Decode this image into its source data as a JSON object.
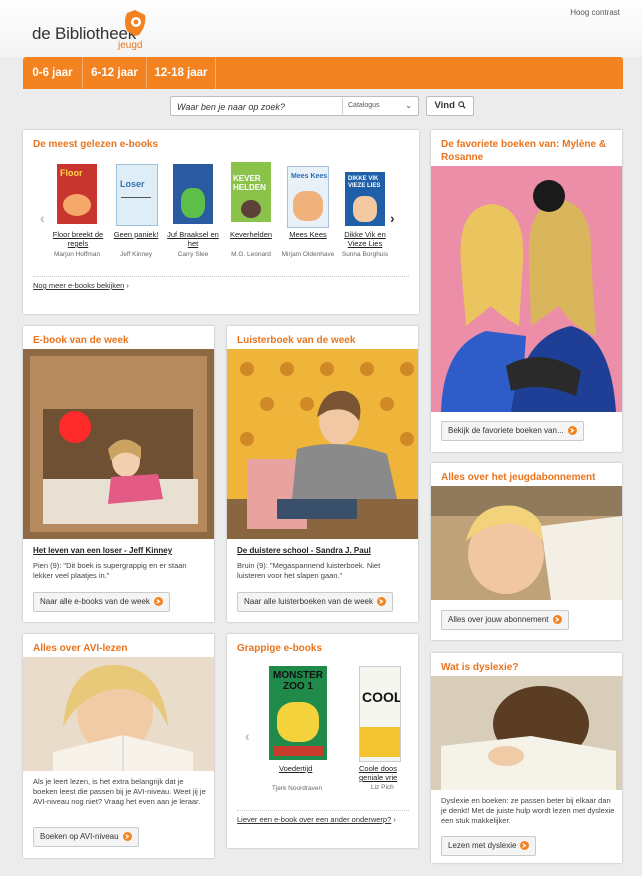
{
  "header": {
    "logo_text": "de Bibliotheek",
    "logo_sub": "jeugd",
    "contrast_link": "Hoog contrast"
  },
  "nav": {
    "tabs": [
      "0-6 jaar",
      "6-12 jaar",
      "12-18 jaar"
    ]
  },
  "search": {
    "placeholder": "Waar ben je naar op zoek?",
    "select_value": "Catalogus",
    "button": "Vind"
  },
  "colors": {
    "accent": "#f38220",
    "title": "#e8741e"
  },
  "most_read": {
    "title": "De meest gelezen e-books",
    "books": [
      {
        "title": "Floor breekt de regels",
        "author": "Marjon Hoffman",
        "color": "#c8352e"
      },
      {
        "title": "Geen paniek!",
        "author": "Jeff Kinney",
        "color": "#8fbcd8"
      },
      {
        "title": "Juf Braaksel en het",
        "author": "Carry Slee",
        "color": "#2a5aa0"
      },
      {
        "title": "Keverhelden",
        "author": "M.G. Leonard",
        "color": "#7cb342"
      },
      {
        "title": "Mees Kees",
        "author": "Mirjam Oldenhave",
        "color": "#3a78c2"
      },
      {
        "title": "Dikke Vik en Vieze Lies",
        "author": "Sunna Borghuis",
        "color": "#1e5fa8"
      }
    ],
    "more_link": "Nog meer e-books bekijken"
  },
  "favorites": {
    "title": "De favoriete boeken van: Mylène & Rosanne",
    "button": "Bekijk de favoriete boeken van..."
  },
  "ebook_week": {
    "title": "E-book van de week",
    "book": "Het leven van een loser - Jeff Kinney",
    "text": "Pien (9): \"Dit boek is supergrappig en er staan lekker veel plaatjes in.\"",
    "button": "Naar alle e-books van de week"
  },
  "audiobook_week": {
    "title": "Luisterboek van de week",
    "book": "De duistere school - Sandra J. Paul",
    "text": "Bruin (9): \"Megaspannend luisterboek. Niet luisteren voor het slapen gaan.\"",
    "button": "Naar alle luisterboeken van de week"
  },
  "subscription": {
    "title": "Alles over het jeugdabonnement",
    "button": "Alles over jouw abonnement"
  },
  "avi": {
    "title": "Alles over AVI-lezen",
    "text": "Als je leert lezen, is het extra belangrijk dat je boeken leest die passen bij je AVI-niveau. Weet jij je AVI-niveau nog niet? Vraag het even aan je leraar.",
    "button": "Boeken op AVI-niveau"
  },
  "funny": {
    "title": "Grappige e-books",
    "books": [
      {
        "title": "Voedertijd",
        "author": "Tjerk Noordraven",
        "cover": "MONSTER ZOO 1"
      },
      {
        "title": "Coole doos geniale vrie",
        "author": "Liz Pich",
        "cover": "COOL"
      }
    ],
    "more_link": "Liever een e-book over een ander onderwerp?"
  },
  "dyslexia": {
    "title": "Wat is dyslexie?",
    "text": "Dyslexie en boeken: ze passen beter bij elkaar dan je denkt! Met de juiste hulp wordt lezen met dyslexie een stuk makkelijker.",
    "button": "Lezen met dyslexie"
  }
}
